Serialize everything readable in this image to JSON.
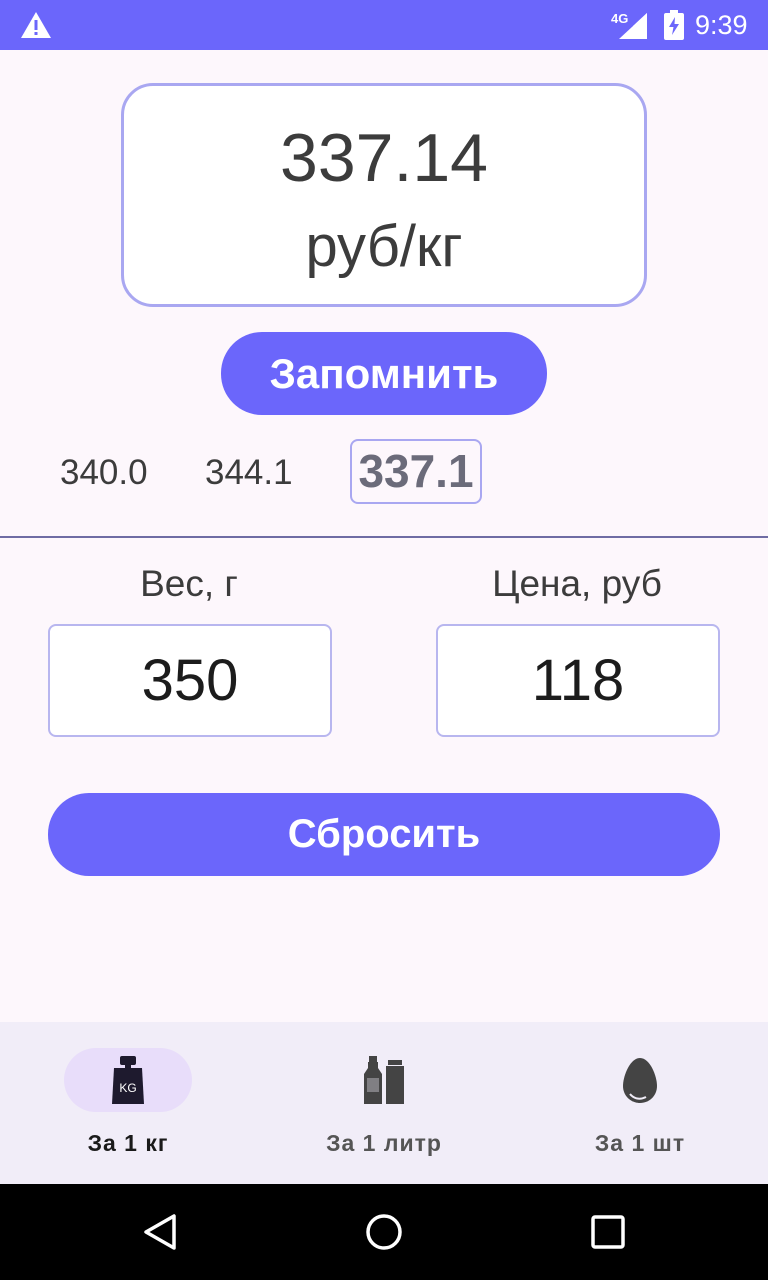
{
  "status_bar": {
    "network": "4G",
    "time": "9:39"
  },
  "result": {
    "value": "337.14",
    "unit": "руб/кг"
  },
  "remember_button": "Запомнить",
  "history": {
    "items": [
      "340.0",
      "344.1"
    ],
    "active": "337.1"
  },
  "fields": {
    "weight": {
      "label": "Вес, г",
      "value": "350"
    },
    "price": {
      "label": "Цена, руб",
      "value": "118"
    }
  },
  "reset_button": "Сбросить",
  "bottom_nav": {
    "items": [
      {
        "label": "За 1 кг",
        "icon": "weight-kg-icon",
        "selected": true
      },
      {
        "label": "За 1 литр",
        "icon": "bottles-icon",
        "selected": false
      },
      {
        "label": "За 1 шт",
        "icon": "egg-icon",
        "selected": false
      }
    ]
  },
  "colors": {
    "accent": "#6b66fb",
    "border": "#a9a7f1",
    "background": "#fdf7fc",
    "nav_background": "#f1edf8",
    "pill": "#e8ddfa"
  }
}
